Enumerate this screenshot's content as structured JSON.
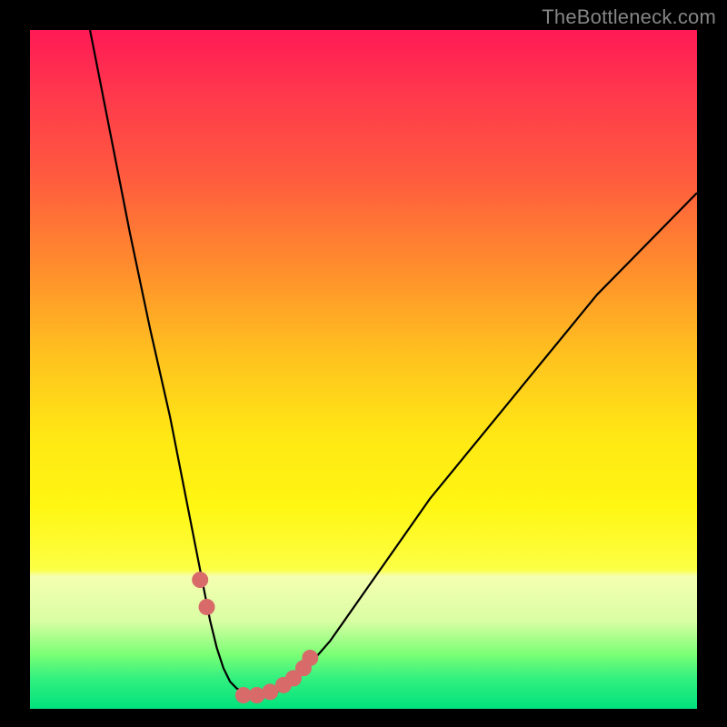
{
  "watermark": "TheBottleneck.com",
  "chart_data": {
    "type": "line",
    "title": "",
    "xlabel": "",
    "ylabel": "",
    "xlim": [
      0,
      100
    ],
    "ylim": [
      0,
      100
    ],
    "series": [
      {
        "name": "curve",
        "x": [
          9,
          12,
          15,
          18,
          21,
          24,
          25,
          26,
          27,
          28,
          29,
          30,
          31,
          32,
          33,
          34,
          35,
          37,
          39,
          41,
          45,
          50,
          55,
          60,
          65,
          70,
          75,
          80,
          85,
          90,
          95,
          100
        ],
        "y": [
          100,
          85,
          70,
          56,
          43,
          28,
          23,
          18,
          13,
          9,
          6,
          4,
          3,
          2.5,
          2,
          2,
          2,
          2.5,
          3.5,
          5.5,
          10,
          17,
          24,
          31,
          37,
          43,
          49,
          55,
          61,
          66,
          71,
          76
        ]
      },
      {
        "name": "markers",
        "x": [
          25.5,
          26.5,
          32,
          34,
          36,
          38,
          39.5,
          41,
          42
        ],
        "y": [
          19,
          15,
          2,
          2,
          2.5,
          3.5,
          4.5,
          6,
          7.5
        ]
      }
    ],
    "colors": {
      "curve": "#000000",
      "markers": "#d86a6a"
    }
  }
}
